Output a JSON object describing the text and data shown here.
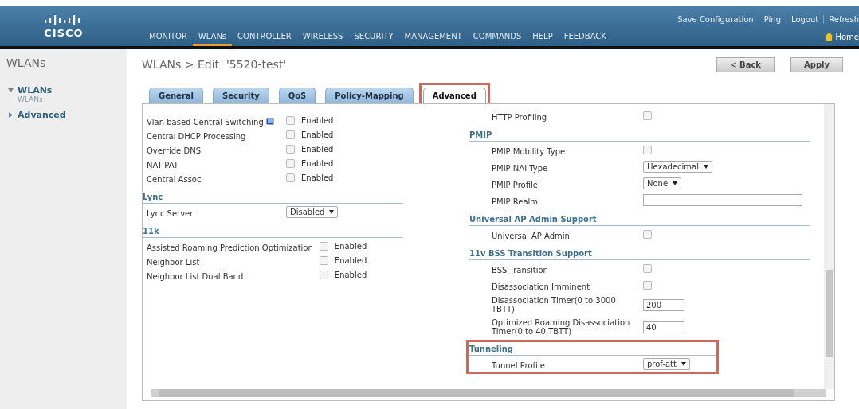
{
  "header": {
    "logo": "CISCO",
    "nav": [
      {
        "label": "MONITOR",
        "selected": false
      },
      {
        "label": "WLANs",
        "selected": true
      },
      {
        "label": "CONTROLLER",
        "selected": false
      },
      {
        "label": "WIRELESS",
        "selected": false
      },
      {
        "label": "SECURITY",
        "selected": false
      },
      {
        "label": "MANAGEMENT",
        "selected": false
      },
      {
        "label": "COMMANDS",
        "selected": false
      },
      {
        "label": "HELP",
        "selected": false
      },
      {
        "label": "FEEDBACK",
        "selected": false
      }
    ],
    "top_links": [
      "Save Configuration",
      "Ping",
      "Logout",
      "Refresh"
    ],
    "home": "Home"
  },
  "sidebar": {
    "title": "WLANs",
    "items": [
      {
        "label": "WLANs",
        "expanded": true,
        "children": [
          {
            "label": "WLANs"
          }
        ]
      },
      {
        "label": "Advanced",
        "expanded": false
      }
    ]
  },
  "page_title": "WLANs > Edit  '5520-test'",
  "buttons": [
    "< Back",
    "Apply"
  ],
  "tabs": [
    {
      "label": "General",
      "selected": false
    },
    {
      "label": "Security",
      "selected": false
    },
    {
      "label": "QoS",
      "selected": false
    },
    {
      "label": "Policy-Mapping",
      "selected": false
    },
    {
      "label": "Advanced",
      "selected": true,
      "highlight": true
    }
  ],
  "left_column": [
    {
      "rows": [
        {
          "kind": "checkbox",
          "label": "Vlan based Central Switching",
          "info": true,
          "checked": false,
          "option": "Enabled"
        },
        {
          "kind": "checkbox",
          "label": "Central DHCP Processing",
          "checked": false,
          "option": "Enabled"
        },
        {
          "kind": "checkbox",
          "label": "Override DNS",
          "checked": false,
          "option": "Enabled"
        },
        {
          "kind": "checkbox",
          "label": "NAT-PAT",
          "checked": false,
          "option": "Enabled"
        },
        {
          "kind": "checkbox",
          "label": "Central Assoc",
          "checked": false,
          "option": "Enabled"
        }
      ]
    },
    {
      "title": "Lync",
      "rows": [
        {
          "kind": "select",
          "label": "Lync Server",
          "value": "Disabled"
        }
      ]
    },
    {
      "title": "11k",
      "rows": [
        {
          "kind": "checkbox",
          "label": "Assisted Roaming Prediction Optimization",
          "checked": false,
          "option": "Enabled"
        },
        {
          "kind": "checkbox",
          "label": "Neighbor List",
          "checked": false,
          "option": "Enabled"
        },
        {
          "kind": "checkbox",
          "label": "Neighbor List Dual Band",
          "checked": false,
          "option": "Enabled"
        }
      ]
    }
  ],
  "right_column": [
    {
      "rows": [
        {
          "kind": "checkbox",
          "label": "HTTP Profiling",
          "checked": false
        }
      ]
    },
    {
      "title": "PMIP",
      "rows": [
        {
          "kind": "checkbox",
          "label": "PMIP Mobility Type",
          "checked": false
        },
        {
          "kind": "select",
          "label": "PMIP NAI Type",
          "value": "Hexadecimal"
        },
        {
          "kind": "select",
          "label": "PMIP Profile",
          "value": "None"
        },
        {
          "kind": "text",
          "label": "PMIP Realm"
        }
      ]
    },
    {
      "title": "Universal AP Admin Support",
      "rows": [
        {
          "kind": "checkbox",
          "label": "Universal AP Admin",
          "checked": false
        }
      ]
    },
    {
      "title": "11v BSS Transition Support",
      "rows": [
        {
          "kind": "checkbox",
          "label": "BSS Transition",
          "checked": false
        },
        {
          "kind": "checkbox",
          "label": "Disassociation Imminent",
          "checked": false
        },
        {
          "kind": "text",
          "label": "Disassociation Timer(0 to 3000 TBTT)",
          "value": "200"
        },
        {
          "kind": "text",
          "label": "Optimized Roaming Disassociation Timer(0 to 40 TBTT)",
          "value": "40"
        }
      ]
    },
    {
      "title": "Tunneling",
      "highlight": true,
      "rows": [
        {
          "kind": "select",
          "label": "Tunnel Profile",
          "value": "prof-att"
        }
      ]
    }
  ]
}
